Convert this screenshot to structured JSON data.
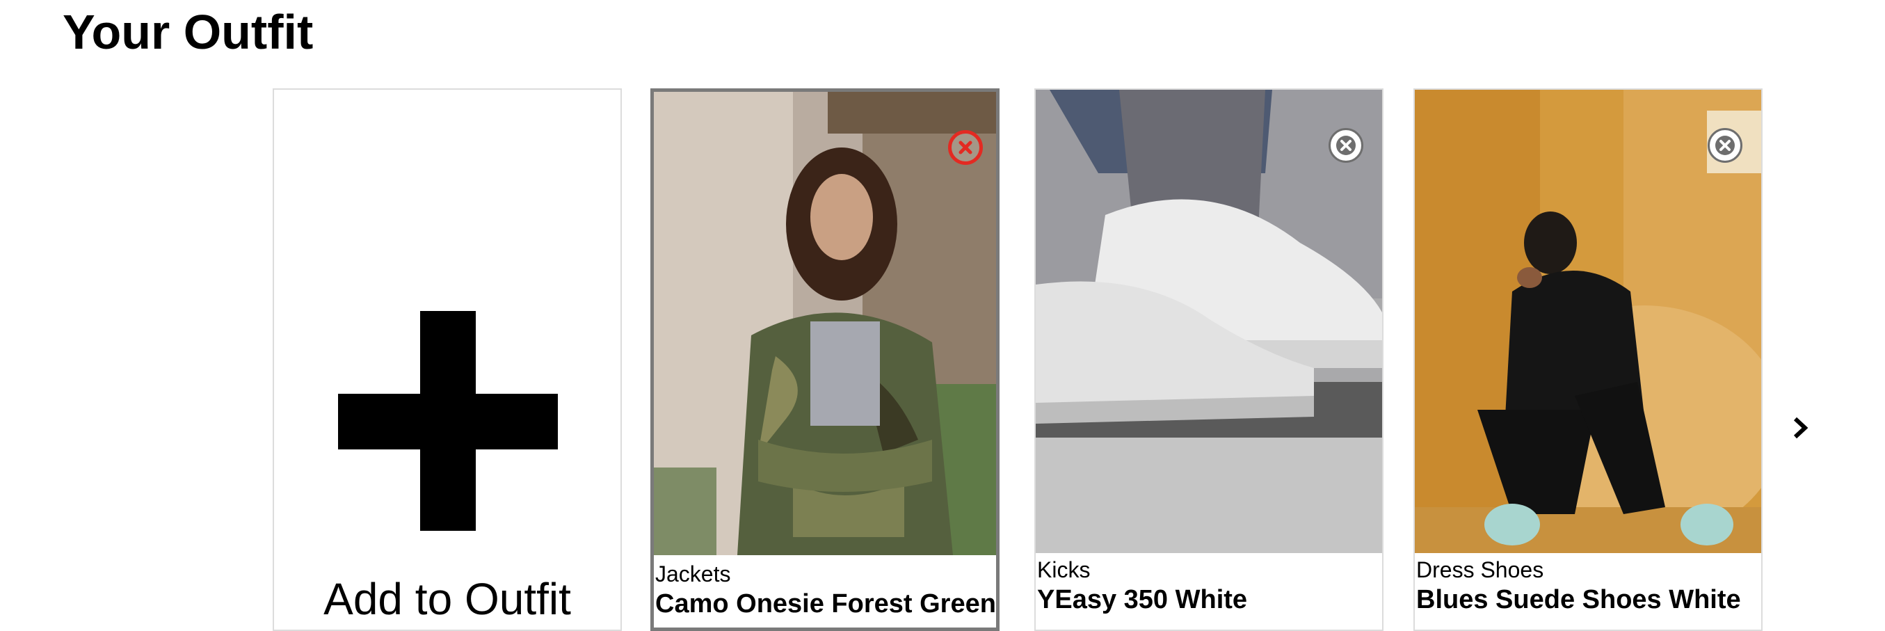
{
  "page": {
    "title": "Your Outfit"
  },
  "add_card": {
    "label": "Add to Outfit",
    "icon": "plus-icon"
  },
  "outfit_items": [
    {
      "category": "Jackets",
      "name": "Camo Onesie Forest Green &",
      "selected": true,
      "remove_icon_color": "#e32a22"
    },
    {
      "category": "Kicks",
      "name": "YEasy 350 White",
      "selected": false,
      "remove_icon_color": "#ffffff"
    },
    {
      "category": "Dress Shoes",
      "name": "Blues Suede Shoes White",
      "selected": false,
      "remove_icon_color": "#ffffff"
    }
  ],
  "carousel": {
    "next_icon": "chevron-right-icon"
  }
}
